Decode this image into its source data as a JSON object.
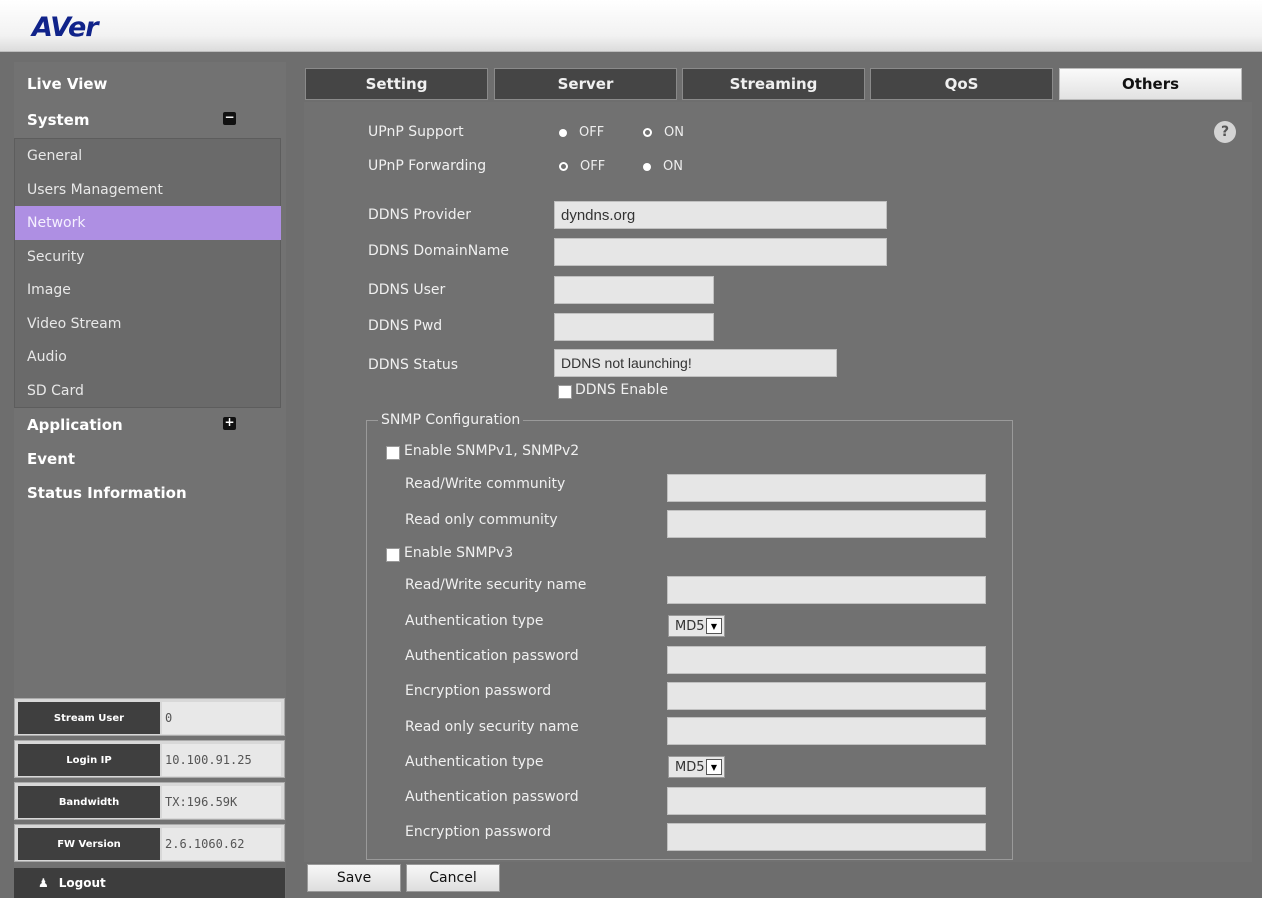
{
  "brand": {
    "logo_text": "AVer"
  },
  "sidebar": {
    "main": [
      {
        "label": "Live View"
      },
      {
        "label": "System",
        "toggle": "−"
      },
      {
        "label": "Application",
        "toggle": "+"
      },
      {
        "label": "Event"
      },
      {
        "label": "Status Information"
      }
    ],
    "system_items": [
      "General",
      "Users Management",
      "Network",
      "Security",
      "Image",
      "Video Stream",
      "Audio",
      "SD Card"
    ],
    "active_item": "Network"
  },
  "info": [
    {
      "label": "Stream User",
      "value": "0"
    },
    {
      "label": "Login IP",
      "value": "10.100.91.25"
    },
    {
      "label": "Bandwidth",
      "value": "TX:196.59K"
    },
    {
      "label": "FW Version",
      "value": "2.6.1060.62"
    }
  ],
  "logout_label": "Logout",
  "tabs": [
    "Setting",
    "Server",
    "Streaming",
    "QoS",
    "Others"
  ],
  "active_tab": "Others",
  "upnp": {
    "support_label": "UPnP Support",
    "forwarding_label": "UPnP Forwarding",
    "off": "OFF",
    "on": "ON"
  },
  "ddns": {
    "provider_label": "DDNS Provider",
    "provider_value": "dyndns.org",
    "domain_label": "DDNS DomainName",
    "domain_value": "",
    "user_label": "DDNS User",
    "user_value": "",
    "pwd_label": "DDNS Pwd",
    "pwd_value": "",
    "status_label": "DDNS Status",
    "status_value": "DDNS not launching!",
    "enable_label": "DDNS Enable"
  },
  "snmp": {
    "legend": "SNMP Configuration",
    "v12_label": "Enable SNMPv1, SNMPv2",
    "rw_community": "Read/Write community",
    "ro_community": "Read only community",
    "v3_label": "Enable SNMPv3",
    "rw_security": "Read/Write security name",
    "auth_type": "Authentication type",
    "auth_type_value": "MD5",
    "auth_pwd": "Authentication password",
    "enc_pwd": "Encryption password",
    "ro_security": "Read only security name",
    "auth_type2": "Authentication type",
    "auth_type2_value": "MD5",
    "auth_pwd2": "Authentication password",
    "enc_pwd2": "Encryption password"
  },
  "buttons": {
    "save": "Save",
    "cancel": "Cancel"
  },
  "help_icon_text": "?"
}
